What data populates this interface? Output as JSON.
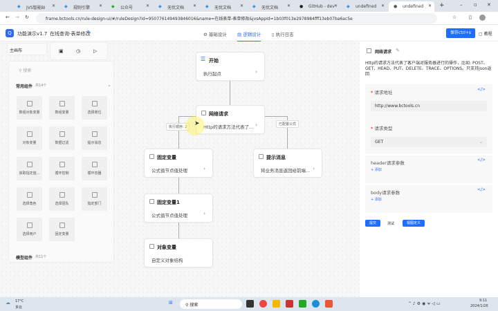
{
  "browser": {
    "tabs": [
      "JVS智能BI",
      "规则引擎",
      "公众号",
      "无忧文档",
      "无忧文档",
      "无忧文档",
      "GitHub - dev",
      "undefined",
      "undefined"
    ],
    "url": "frame.bctools.cn/rule-design-ui/#/ruleDesign?id=950776149493846016&name=在线表单-表单修改&jvsAppId=1b03f013e2978984fff13eb07ba6ac5e"
  },
  "header": {
    "app": "功能演示v1.7",
    "breadcrumb": "在线查询-表单修改",
    "nav": [
      "基础设计",
      "逻辑设计",
      "执行日志"
    ],
    "save": "保存ctrl+s",
    "help": "教程"
  },
  "left": {
    "canvas_tab": "主画布",
    "search_placeholder": "搜索",
    "group1": {
      "title": "常用组件",
      "count": "共14个",
      "items": [
        "数组对象变量",
        "数组变量",
        "选择岗位",
        "对象变量",
        "数据过滤",
        "提示消息",
        "获取指定值...",
        "循环控制",
        "循环容器",
        "选择角色",
        "选择团队",
        "指定部门",
        "选择用户",
        "固定变量"
      ]
    },
    "group2": {
      "title": "模型组件",
      "count": "共11个"
    }
  },
  "flow": {
    "nodes": [
      {
        "title": "开始",
        "desc": "执行起点"
      },
      {
        "title": "网络请求",
        "desc": "Http的请求方法代表了..."
      },
      {
        "title": "固定变量",
        "desc": "公式值节点值处理"
      },
      {
        "title": "提示消息",
        "desc": "将业务消息返回给前端..."
      },
      {
        "title": "固定变量1",
        "desc": "公式值节点值处理"
      },
      {
        "title": "对象变量",
        "desc": "自定义对象结构"
      }
    ],
    "labels": [
      "执行顺序: 2",
      "已配置公式"
    ]
  },
  "right": {
    "title": "网络请求",
    "desc": "Http的请求方法代表了客户端对服务器进行的操作，比如: POST、GET、HEAD、PUT、DELETE、TRACE、OPTIONS。只支持json返回",
    "url_label": "请求地址",
    "url_value": "http://www.bctools.cn",
    "type_label": "请求类型",
    "type_value": "GET",
    "header_label": "header请求参数",
    "body_label": "body请求参数",
    "add": "+ 添加",
    "submit": "提交",
    "test": "测试",
    "custom": "视图定义"
  },
  "taskbar": {
    "temp": "17°C",
    "weather": "多云",
    "search": "搜索",
    "time": "9:11",
    "date": "2024/1/26"
  }
}
